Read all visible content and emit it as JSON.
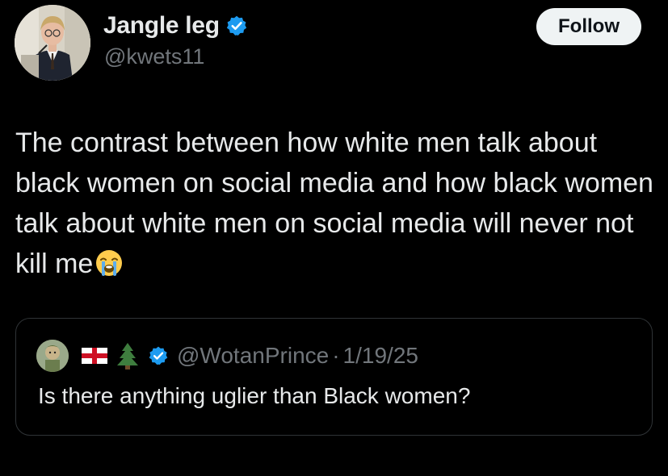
{
  "author": {
    "display_name": "Jangle leg",
    "handle": "@kwets11",
    "verified": true,
    "avatar_icon": "person-at-podium-avatar"
  },
  "follow_button": {
    "label": "Follow"
  },
  "tweet": {
    "text": "The contrast between how white men talk about black women on social media and how black women talk about white men on social media will never not kill me",
    "emoji": "loudly-crying-face"
  },
  "quoted_tweet": {
    "handle": "@WotanPrince",
    "separator": "·",
    "date": "1/19/25",
    "text": "Is there anything uglier than Black women?",
    "name_emojis": [
      "england-flag",
      "evergreen-tree"
    ],
    "verified": true
  },
  "colors": {
    "background": "#000000",
    "text_primary": "#e7e9ea",
    "text_secondary": "#71767b",
    "verified_blue": "#1d9bf0",
    "follow_bg": "#eff3f4",
    "border": "#2f3336"
  }
}
